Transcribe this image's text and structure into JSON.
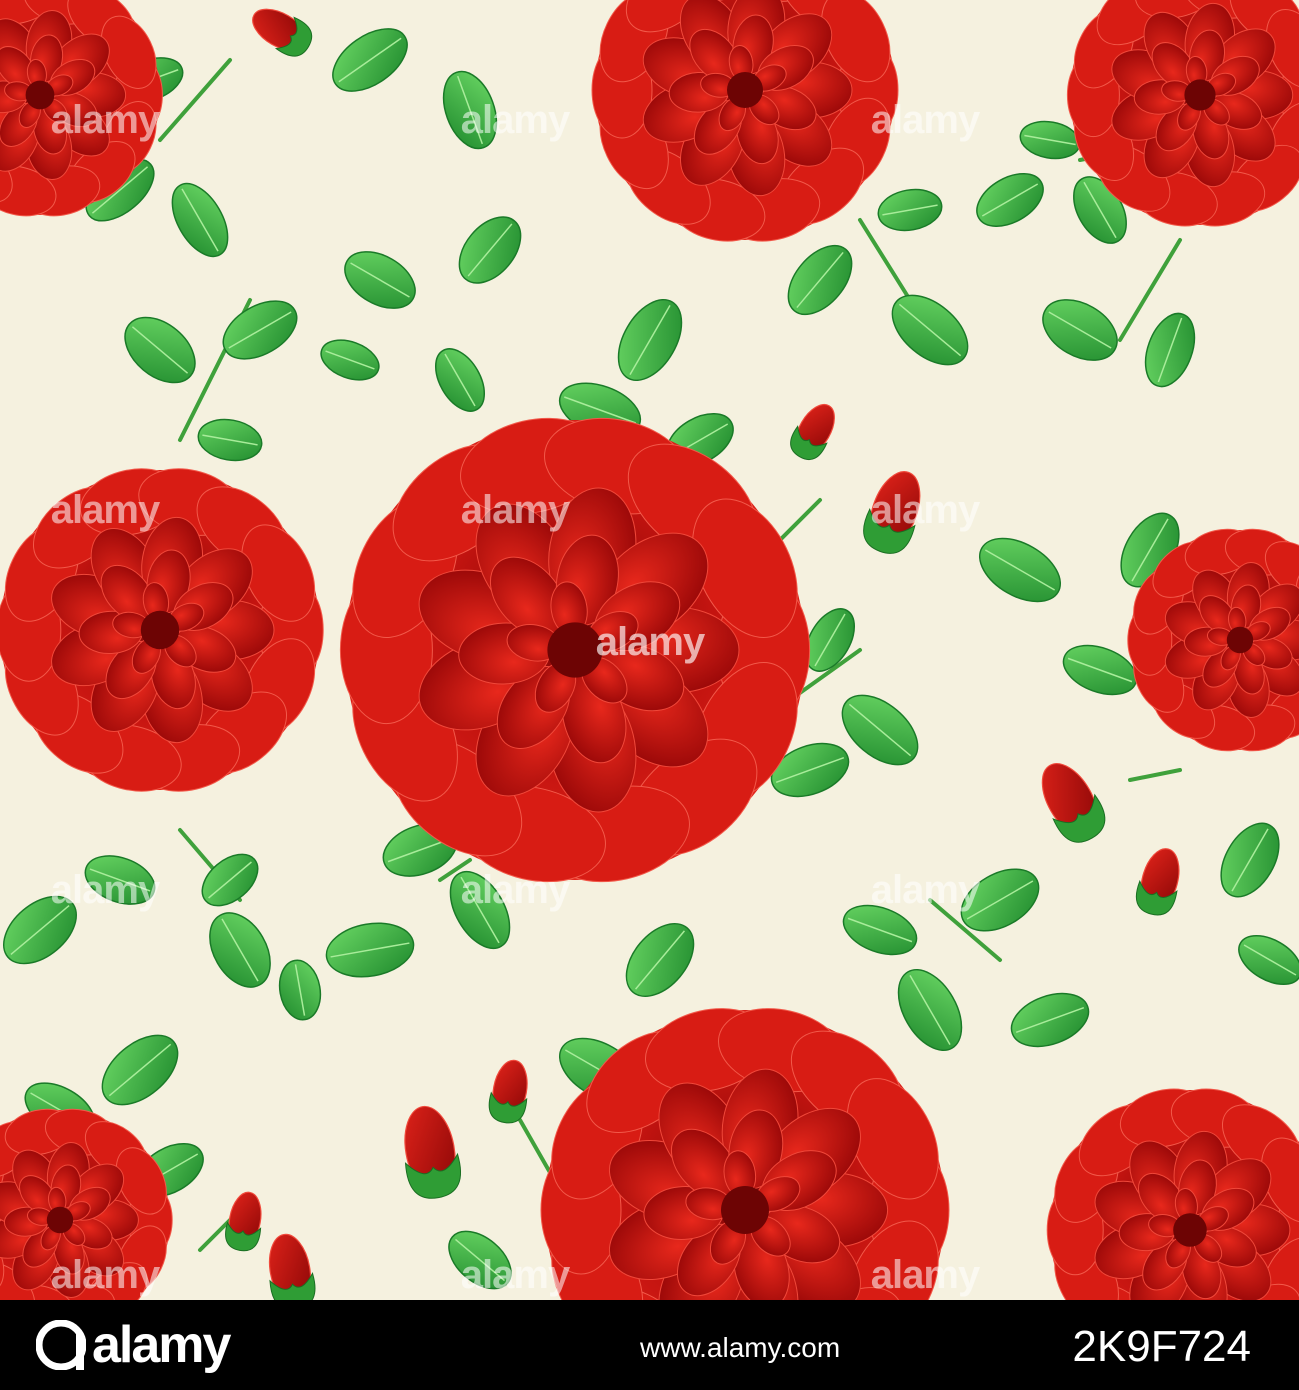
{
  "image": {
    "subject": "Seamless pattern of red roses with buds and green leaves on a cream background",
    "background_color": "#f5f1df",
    "petal_colors": [
      "#b50d0d",
      "#e01a14",
      "#7d0606"
    ],
    "leaf_colors": [
      "#2fa83a",
      "#5cd05a",
      "#1e7a2c"
    ]
  },
  "watermark": {
    "text": "alamy"
  },
  "footer": {
    "brand": "alamy",
    "image_id": "2K9F724",
    "url": "www.alamy.com"
  }
}
